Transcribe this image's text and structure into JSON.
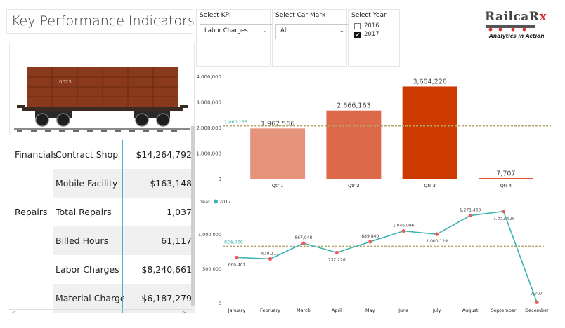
{
  "header": {
    "title": "Key Performance Indicators"
  },
  "image": {
    "car_number": "0023"
  },
  "slicers": {
    "kpi": {
      "label": "Select KPI",
      "value": "Labor Charges"
    },
    "car_mark": {
      "label": "Select Car Mark",
      "value": "All"
    },
    "year": {
      "label": "Select Year",
      "options": [
        {
          "label": "2016",
          "checked": false
        },
        {
          "label": "2017",
          "checked": true
        }
      ]
    }
  },
  "logo": {
    "brand": "RailcaR",
    "brand_rx": "x",
    "tagline": "Analytics in Action"
  },
  "table": {
    "rows": [
      {
        "group": "Financials",
        "metric": "Contract Shop",
        "value": "$14,264,792"
      },
      {
        "group": "",
        "metric": "Mobile Facility",
        "value": "$163,148"
      },
      {
        "group": "Repairs",
        "metric": "Total Repairs",
        "value": "1,037"
      },
      {
        "group": "",
        "metric": "Billed Hours",
        "value": "61,117"
      },
      {
        "group": "",
        "metric": "Labor Charges",
        "value": "$8,240,661"
      },
      {
        "group": "",
        "metric": "Material Charges",
        "value": "$6,187,279"
      }
    ],
    "scroll_left_glyph": "<",
    "scroll_right_glyph": ">"
  },
  "colors": {
    "accent": "#3bb3b0",
    "bar1": "#e5937a",
    "bar2": "#dc6a4a",
    "bar3": "#cc3a00",
    "bar4": "#e8553a",
    "avg_line": "#b8a36a",
    "point": "#ee5a5a"
  },
  "chart_data": [
    {
      "type": "bar",
      "categories": [
        "Qtr 1",
        "Qtr 2",
        "Qtr 3",
        "Qtr 4"
      ],
      "values": [
        1962566,
        2666163,
        3604226,
        7707
      ],
      "value_labels": [
        "1,962,566",
        "2,666,163",
        "3,604,226",
        "7,707"
      ],
      "yticks": [
        "0",
        "1,000,000",
        "2,000,000",
        "3,000,000",
        "4,000,000"
      ],
      "ylim": [
        0,
        4000000
      ],
      "average": 2060165,
      "average_label": "2,060,165",
      "grid": false,
      "title": "",
      "xlabel": "",
      "ylabel": ""
    },
    {
      "type": "line",
      "legend_title": "Year",
      "series": [
        {
          "name": "2017",
          "values": [
            660401,
            639117,
            867048,
            732226,
            889840,
            1046096,
            1000129,
            1271469,
            1332629,
            7707
          ]
        }
      ],
      "categories": [
        "January",
        "February",
        "March",
        "April",
        "May",
        "June",
        "July",
        "August",
        "September",
        "December"
      ],
      "value_labels": [
        "660,401",
        "639,117",
        "867,048",
        "732,226",
        "889,840",
        "1,046,096",
        "1,000,129",
        "1,271,469",
        "1,332,629",
        "7,707"
      ],
      "yticks": [
        "0",
        "500,000",
        "1,000,000"
      ],
      "ylim": [
        0,
        1400000
      ],
      "average": 824066,
      "average_label": "824,066",
      "legend_position": "top-left",
      "grid": false,
      "title": "",
      "xlabel": "",
      "ylabel": ""
    }
  ]
}
